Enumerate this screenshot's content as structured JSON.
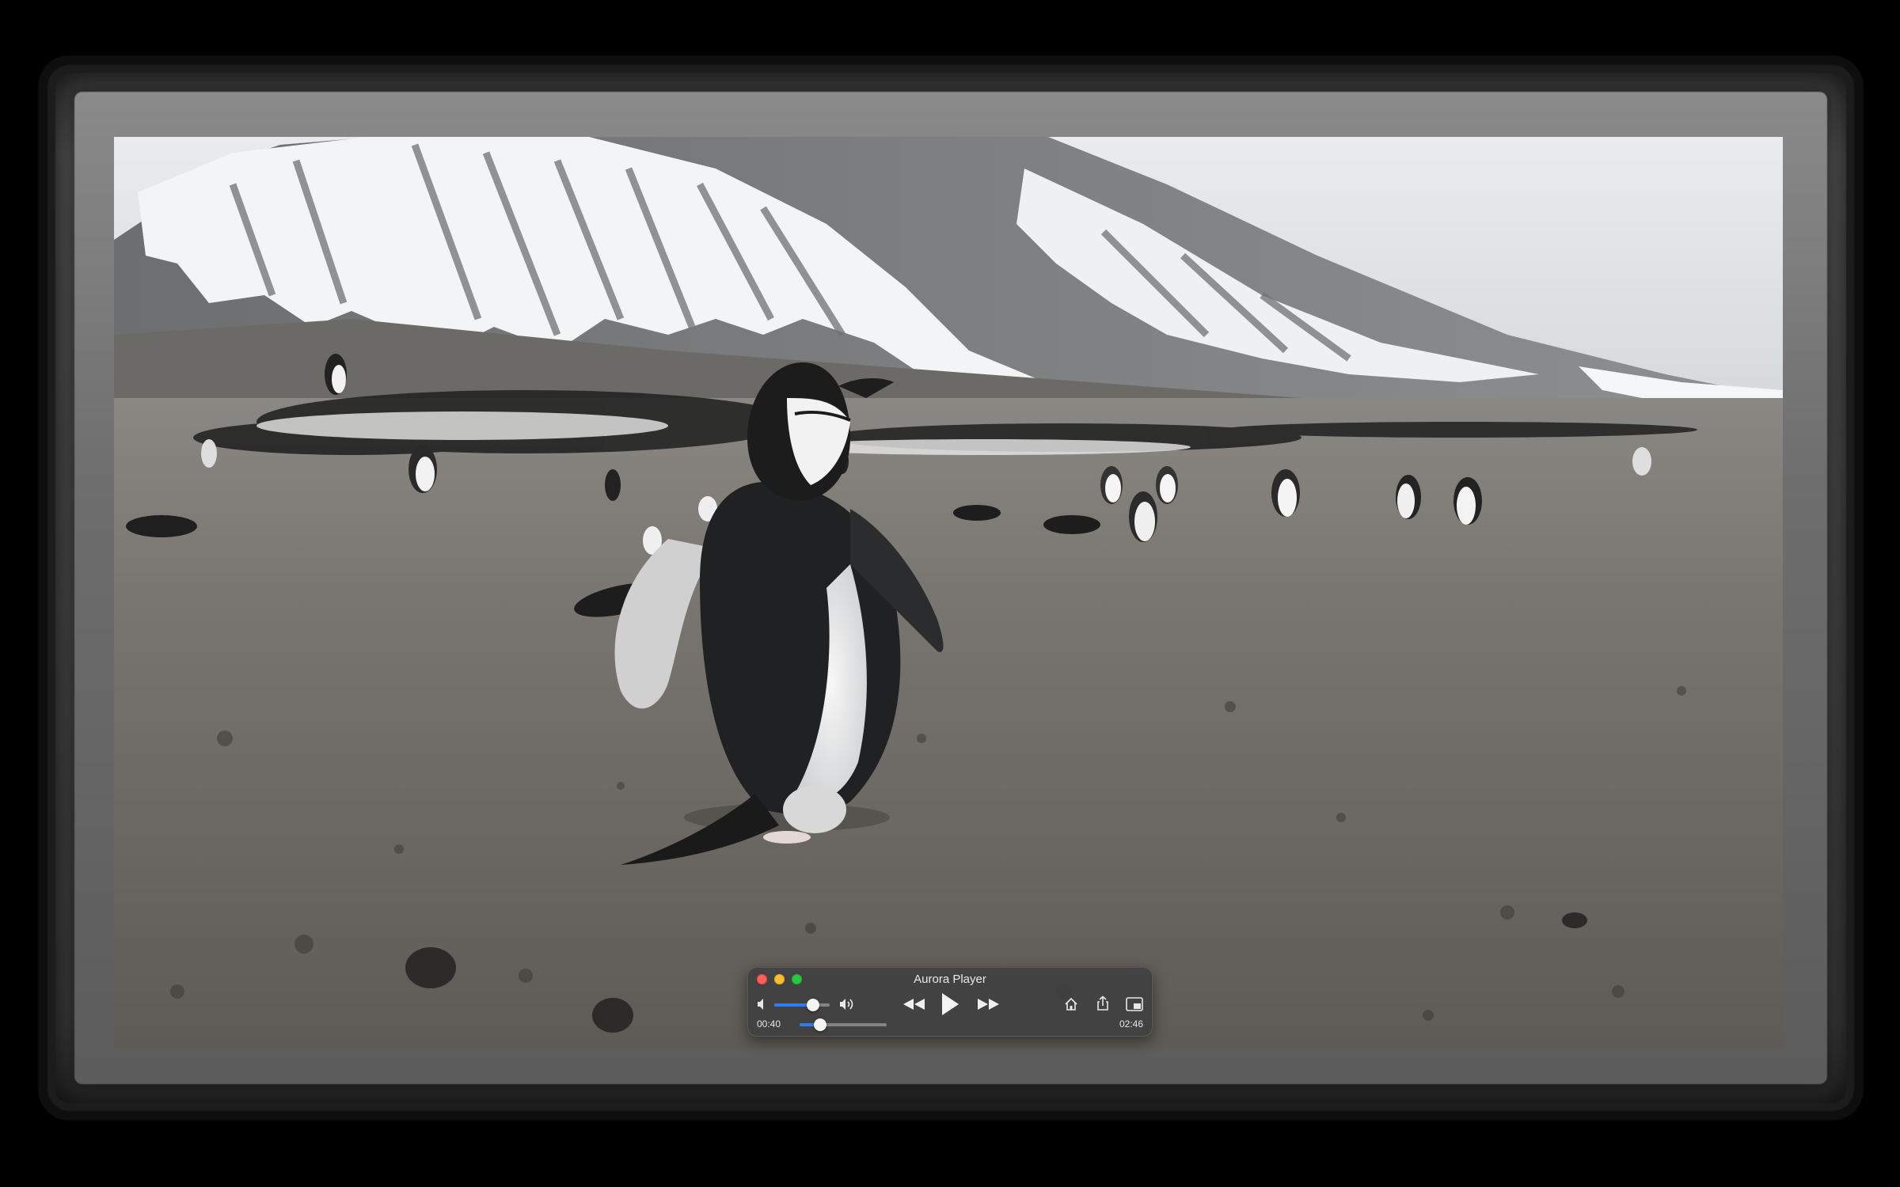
{
  "player": {
    "title": "Aurora Player",
    "current_time": "00:40",
    "total_time": "02:46",
    "progress_fraction": 0.24,
    "volume_fraction": 0.7,
    "state": "paused"
  },
  "controls": {
    "left": [
      "volume-mute-icon",
      "volume-slider",
      "volume-up-icon"
    ],
    "center": [
      "rewind-icon",
      "play-icon",
      "fast-forward-icon"
    ],
    "right": [
      "home-icon",
      "share-icon",
      "picture-in-picture-icon"
    ]
  },
  "colors": {
    "accent": "#2f7bf6",
    "close": "#fe5f57",
    "minimize": "#febc2e",
    "maximize": "#28c840"
  }
}
